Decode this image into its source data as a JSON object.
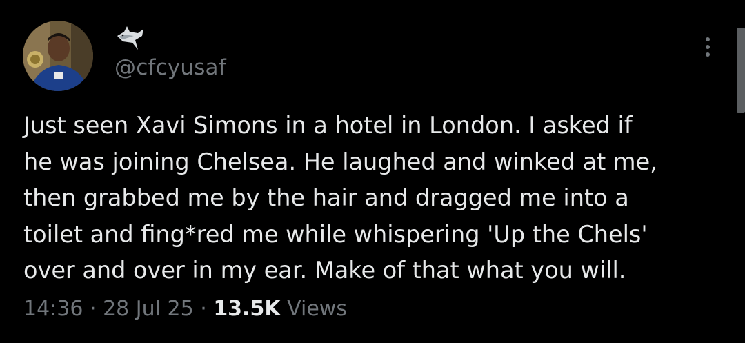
{
  "user": {
    "handle": "@cfcyusaf",
    "display_name_icon": "shark-icon"
  },
  "tweet": {
    "text": "Just seen Xavi Simons in a hotel in London. I asked if\nhe was joining Chelsea. He laughed and winked at me,\nthen grabbed me by the hair and dragged me into a\ntoilet and fing*red me while whispering 'Up the Chels'\nover and over in my ear. Make of that what you will.",
    "time": "14:36",
    "separator": " · ",
    "date": "28 Jul 25",
    "views_count": "13.5K",
    "views_label": "Views"
  },
  "icons": {
    "more": "more-options-icon"
  },
  "colors": {
    "background": "#000000",
    "text_primary": "#e7e9ea",
    "text_secondary": "#71767b"
  }
}
